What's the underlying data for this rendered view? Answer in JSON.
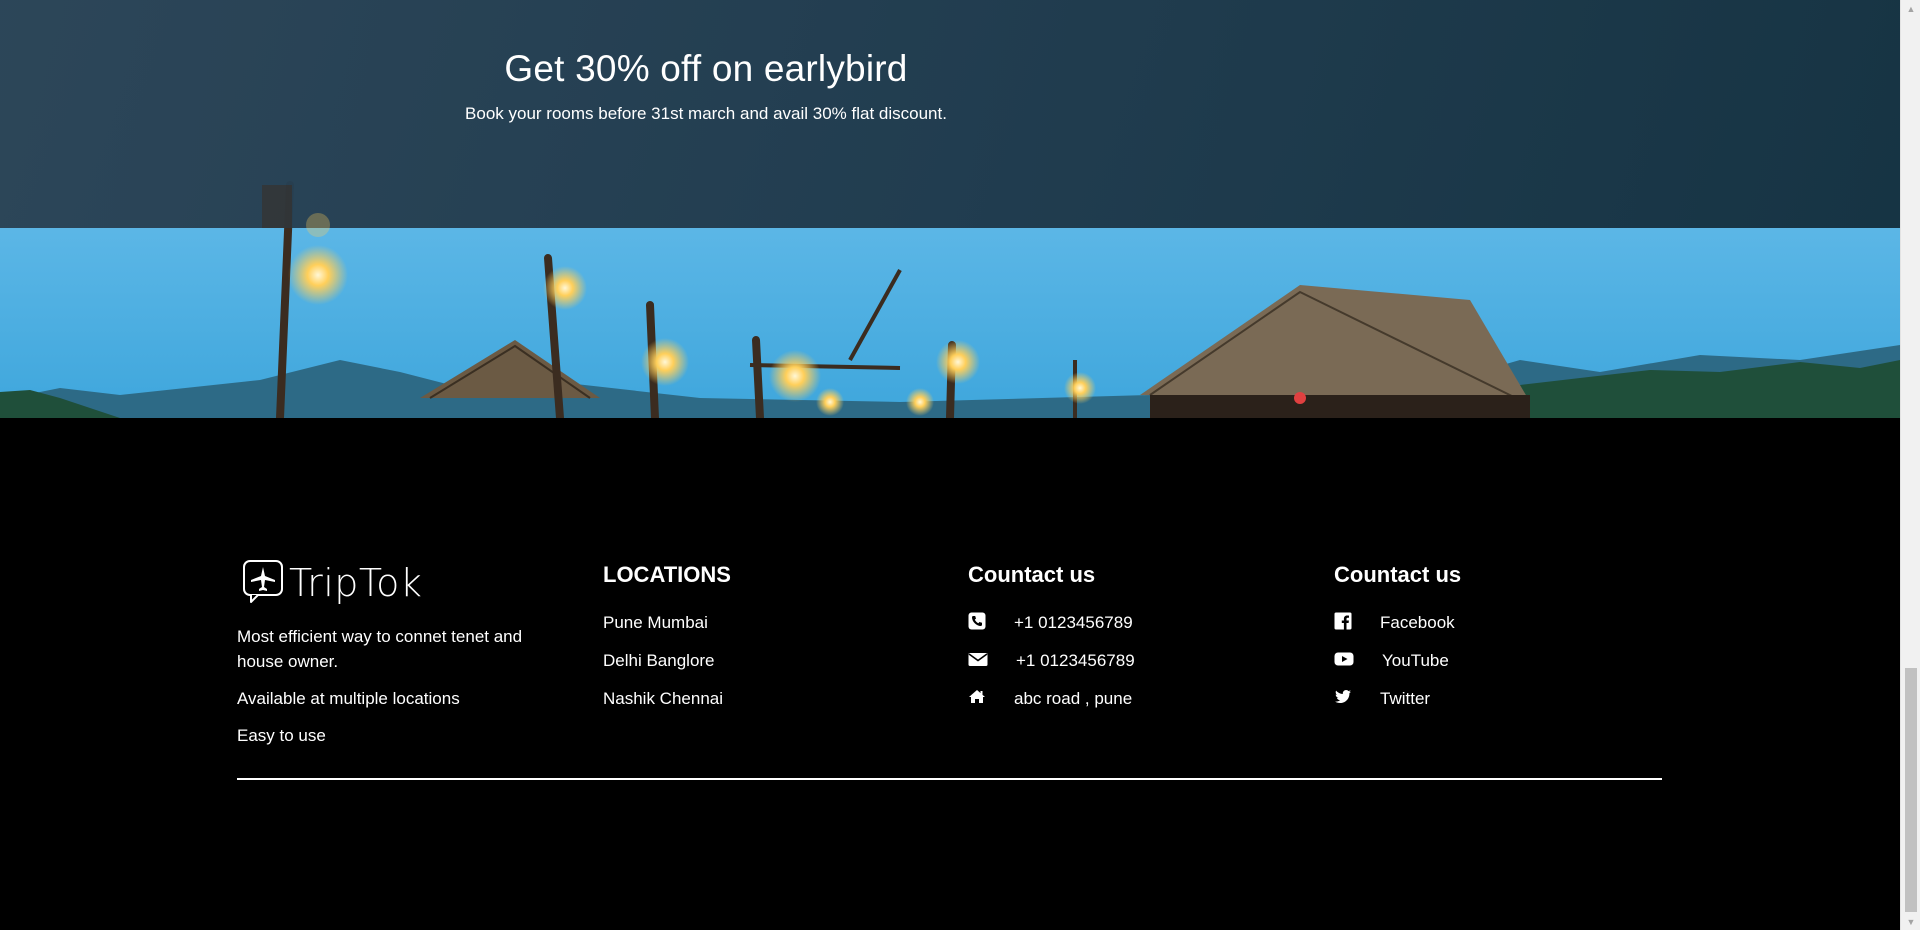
{
  "promo": {
    "title": "Get 30% off on earlybird",
    "subtitle": "Book your rooms before 31st march and avail 30% flat discount."
  },
  "brand": {
    "name": "TripTok",
    "logo_icon": "plane-chat-icon",
    "lines": [
      "Most efficient way to connet tenet and house owner.",
      "Available at multiple locations",
      "Easy to use"
    ]
  },
  "locations": {
    "title": "LOCATIONS",
    "items": [
      "Pune Mumbai",
      "Delhi Banglore",
      "Nashik Chennai"
    ]
  },
  "contact": {
    "title": "Countact us",
    "items": [
      {
        "icon": "phone-icon",
        "text": "+1 0123456789"
      },
      {
        "icon": "envelope-icon",
        "text": "+1 0123456789"
      },
      {
        "icon": "home-icon",
        "text": "abc road , pune"
      }
    ]
  },
  "social": {
    "title": "Countact us",
    "items": [
      {
        "icon": "facebook-icon",
        "text": "Facebook"
      },
      {
        "icon": "youtube-icon",
        "text": "YouTube"
      },
      {
        "icon": "twitter-icon",
        "text": "Twitter"
      }
    ]
  },
  "colors": {
    "footer_bg": "#000000",
    "hero_overlay": "#1f3a4c",
    "sky": "#57b6e6",
    "text": "#ffffff"
  }
}
